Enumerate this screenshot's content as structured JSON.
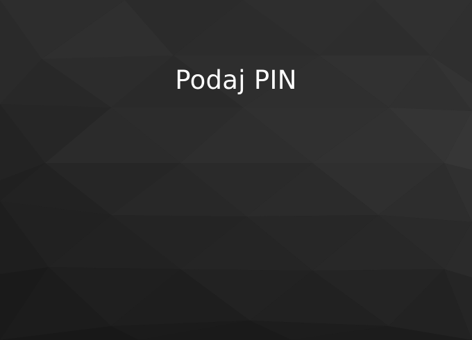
{
  "screen": {
    "title": "Podaj PIN",
    "background_style": "dark-low-poly"
  },
  "colors": {
    "text": "#ffffff",
    "background": "#262626"
  }
}
